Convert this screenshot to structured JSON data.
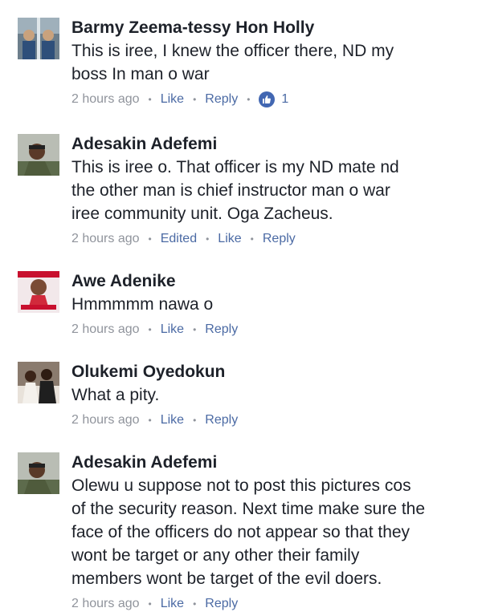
{
  "comments": [
    {
      "author": "Barmy Zeema-tessy Hon Holly",
      "lines": [
        "This is iree,  I knew the officer there,  ND my",
        "boss In man o war"
      ],
      "time": "2 hours ago",
      "actions": [
        "Like",
        "Reply"
      ],
      "reaction_count": "1",
      "avatar_icon": "profile-photo"
    },
    {
      "author": "Adesakin Adefemi",
      "lines": [
        "This is iree o. That officer is my ND mate nd",
        "the other man is chief instructor man o war",
        "iree community unit. Oga Zacheus."
      ],
      "time": "2 hours ago",
      "edited": "Edited",
      "actions": [
        "Like",
        "Reply"
      ],
      "avatar_icon": "profile-photo"
    },
    {
      "author": "Awe Adenike",
      "lines": [
        "Hmmmmm nawa o"
      ],
      "time": "2 hours ago",
      "actions": [
        "Like",
        "Reply"
      ],
      "avatar_icon": "profile-photo"
    },
    {
      "author": "Olukemi Oyedokun",
      "lines": [
        "What a pity."
      ],
      "time": "2 hours ago",
      "actions": [
        "Like",
        "Reply"
      ],
      "avatar_icon": "profile-photo"
    },
    {
      "author": "Adesakin Adefemi",
      "lines": [
        "Olewu u suppose not to post this pictures cos",
        "of the security reason. Next time make sure the",
        "face of the officers do not appear so that they",
        "wont be target or any other their family",
        "members wont be target of the evil doers."
      ],
      "time": "2 hours ago",
      "actions": [
        "Like",
        "Reply"
      ],
      "avatar_icon": "profile-photo"
    }
  ],
  "colors": {
    "author_text": "#1d2129",
    "meta_text": "#90949c",
    "action_link": "#4b6aa4",
    "like_badge": "#4267b2"
  }
}
